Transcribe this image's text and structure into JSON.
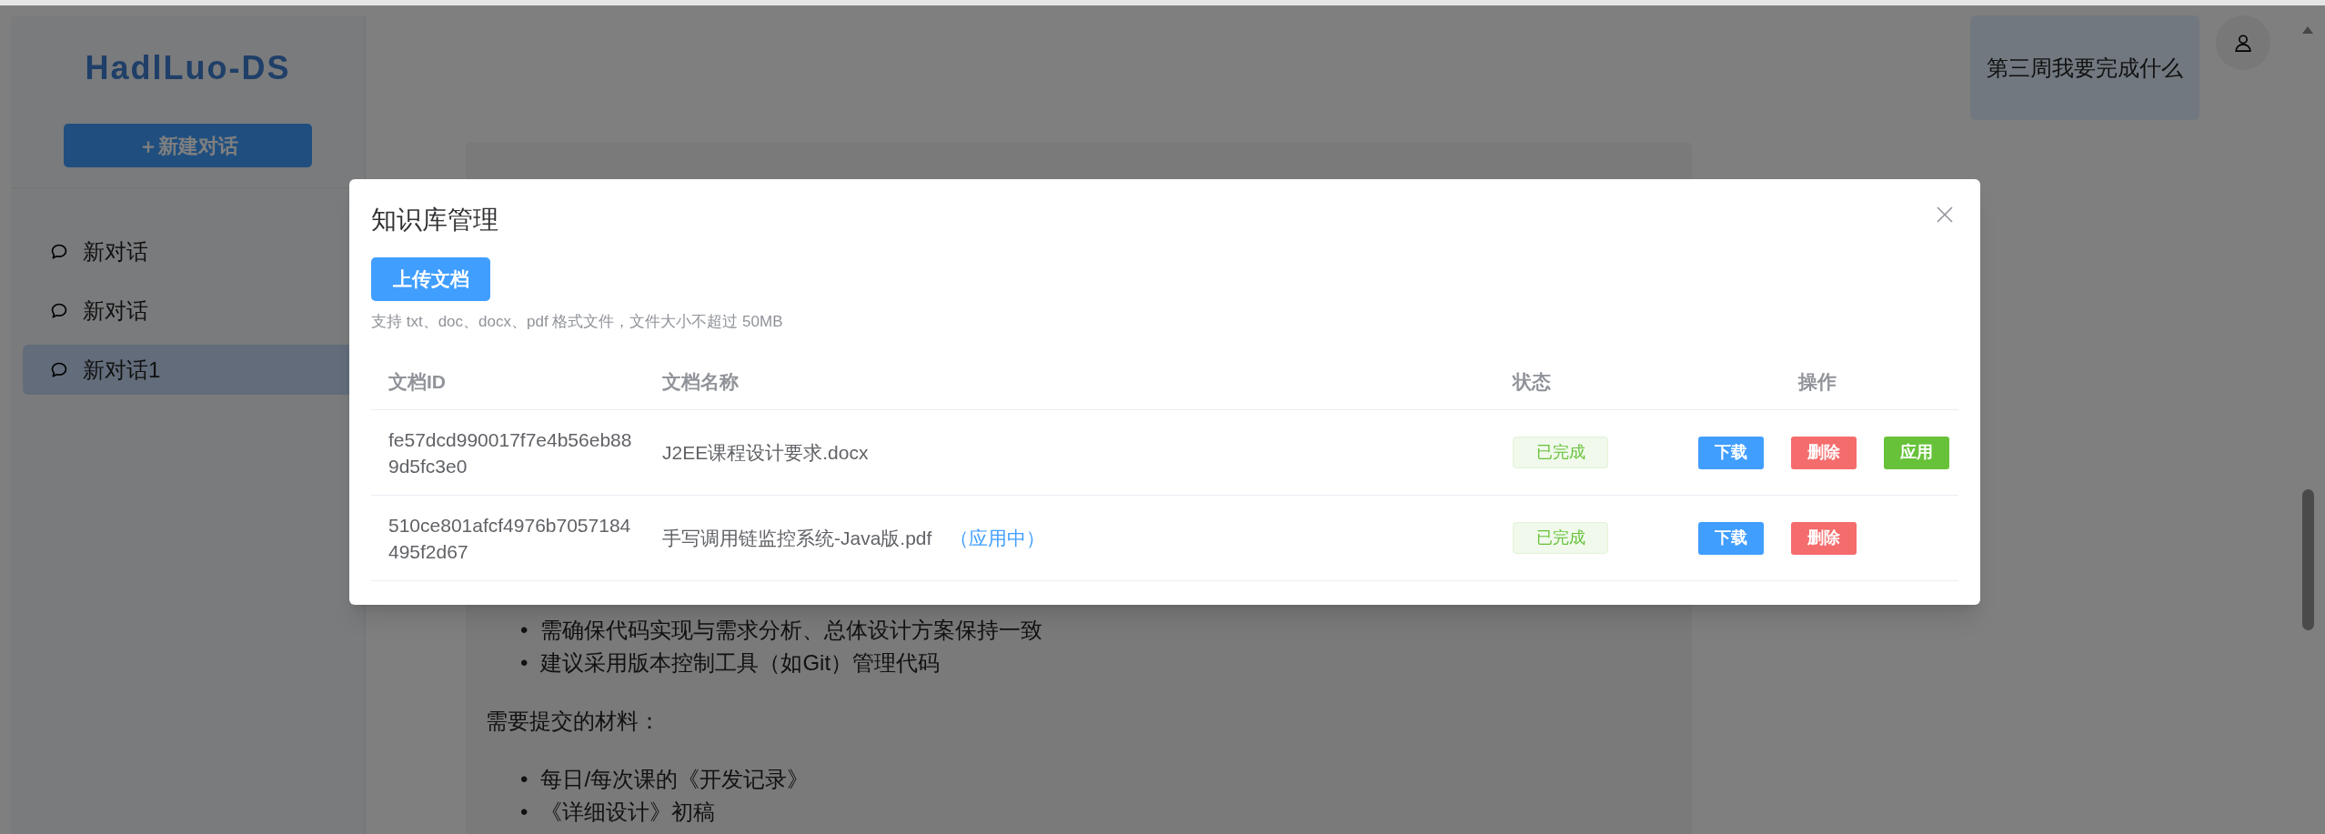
{
  "sidebar": {
    "title": "HadlLuo-DS",
    "new_chat_button": "＋新建对话",
    "conversations": [
      {
        "label": "新对话",
        "selected": false
      },
      {
        "label": "新对话",
        "selected": false
      },
      {
        "label": "新对话1",
        "selected": true
      }
    ]
  },
  "chat": {
    "user_message": "第三周我要完成什么",
    "assistant": {
      "bullets_top": [
        {
          "marker": "•",
          "text": "需确保代码实现与需求分析、总体设计方案保持一致"
        },
        {
          "marker": "•",
          "text": "建议采用版本控制工具（如Git）管理代码"
        }
      ],
      "paragraph": "需要提交的材料：",
      "bullets_bottom": [
        {
          "marker": "•",
          "text": "每日/每次课的《开发记录》"
        },
        {
          "marker": "•",
          "text": "《详细设计》初稿"
        }
      ]
    }
  },
  "dialog": {
    "title": "知识库管理",
    "upload_button": "上传文档",
    "hint": "支持 txt、doc、docx、pdf 格式文件，文件大小不超过 50MB",
    "columns": [
      "文档ID",
      "文档名称",
      "状态",
      "操作"
    ],
    "rows": [
      {
        "id": "fe57dcd990017f7e4b56eb889d5fc3e0",
        "name": "J2EE课程设计要求.docx",
        "status": "已完成",
        "actions": [
          {
            "label": "下载",
            "kind": "primary"
          },
          {
            "label": "删除",
            "kind": "danger"
          },
          {
            "label": "应用",
            "kind": "success"
          }
        ]
      },
      {
        "id": "510ce801afcf4976b7057184495f2d67",
        "name": "手写调用链监控系统-Java版.pdf",
        "in_use_label": "（应用中）",
        "status": "已完成",
        "actions": [
          {
            "label": "下载",
            "kind": "primary"
          },
          {
            "label": "删除",
            "kind": "danger"
          }
        ]
      }
    ]
  }
}
